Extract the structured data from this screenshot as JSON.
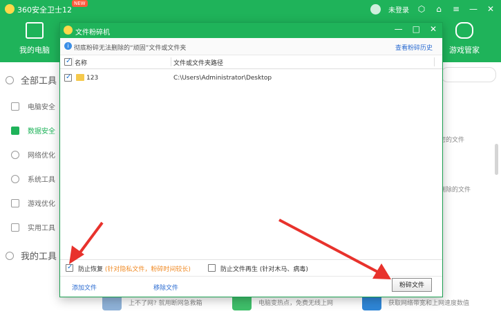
{
  "app": {
    "title": "360安全卫士12",
    "badge": "NEW",
    "user": "未登录"
  },
  "nav": {
    "left_label": "我的电脑",
    "right_label": "游戏管家"
  },
  "sidebar": {
    "header": "全部工具",
    "items": [
      {
        "label": "电脑安全"
      },
      {
        "label": "数据安全"
      },
      {
        "label": "网络优化"
      },
      {
        "label": "系统工具"
      },
      {
        "label": "游戏优化"
      },
      {
        "label": "实用工具"
      }
    ],
    "bottom": "我的工具"
  },
  "content": {
    "right_text_1": "密的文件",
    "right_text_2": "删除的文件",
    "features": [
      "上不了网? 就用断网急救箱",
      "电脑变热点，免费无线上网",
      "获取网络带宽和上网速度数值"
    ]
  },
  "dialog": {
    "title": "文件粉碎机",
    "info_text": "彻底粉碎无法删除的“顽固”文件或文件夹",
    "history_link": "查看粉碎历史",
    "columns": {
      "name": "名称",
      "path": "文件或文件夹路径"
    },
    "rows": [
      {
        "name": "123",
        "path": "C:\\Users\\Administrator\\Desktop",
        "checked": true
      }
    ],
    "options": {
      "prevent_recovery": "防止恢复",
      "prevent_recovery_hint": "(针对隐私文件，粉碎时间较长)",
      "prevent_regen": "防止文件再生",
      "prevent_regen_hint": "(针对木马、病毒)"
    },
    "actions": {
      "add_file": "添加文件",
      "remove_file": "移除文件",
      "shred": "粉碎文件"
    }
  },
  "colors": {
    "brand_green": "#1fb35a",
    "link_blue": "#2a6bd1",
    "hint_orange": "#f08a24",
    "arrow_red": "#e8322c"
  }
}
